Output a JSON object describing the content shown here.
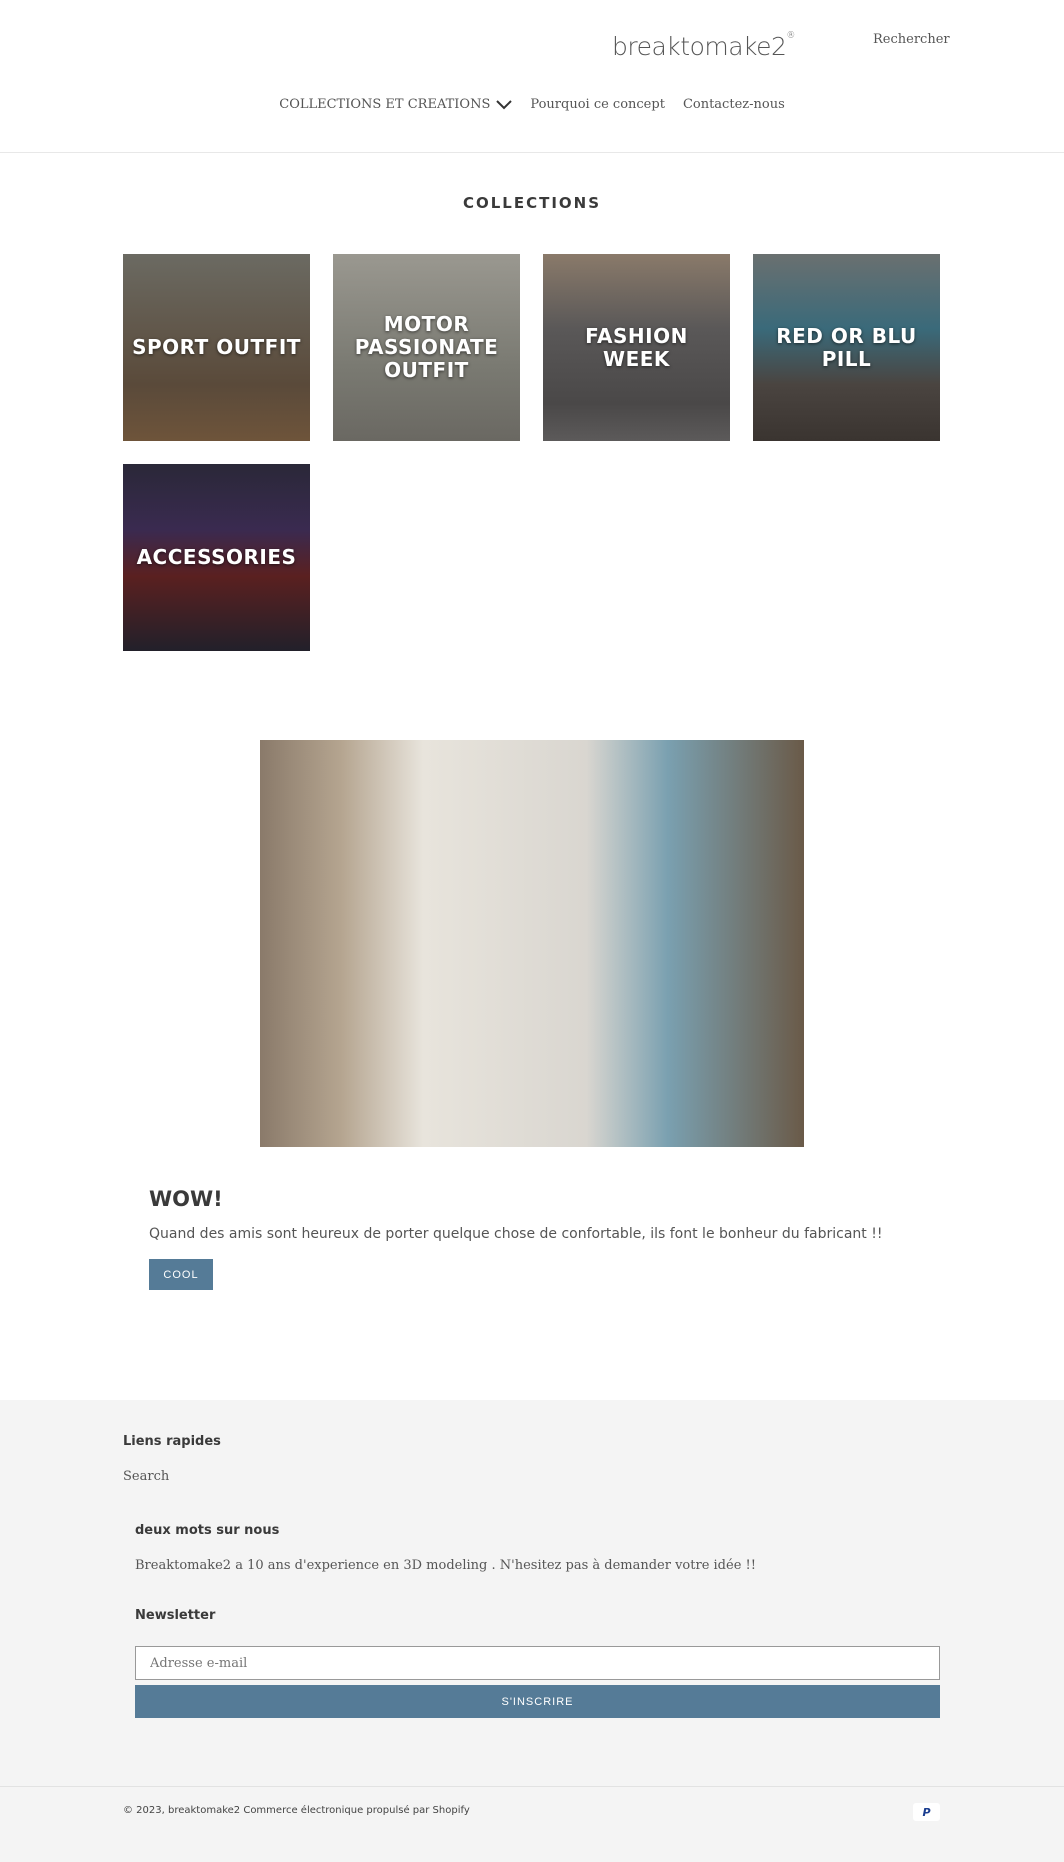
{
  "header": {
    "logo": "breaktomake2",
    "logo_mark": "®",
    "search": "Rechercher",
    "nav": [
      {
        "label": "COLLECTIONS ET CREATIONS"
      },
      {
        "label": "Pourquoi ce concept"
      },
      {
        "label": "Contactez-nous"
      }
    ]
  },
  "collections": {
    "title": "COLLECTIONS",
    "items": [
      {
        "label": "SPORT OUTFIT",
        "color": "#5e5548"
      },
      {
        "label": "MOTOR PASSIONATE OUTFIT",
        "color": "#7d7a72"
      },
      {
        "label": "FASHION WEEK",
        "color": "#5c5a5a"
      },
      {
        "label": "RED OR BLU PILL",
        "color": "#4e5a60"
      },
      {
        "label": "ACCESSORIES",
        "color": "#2c2838"
      }
    ]
  },
  "feature": {
    "title": "WOW!",
    "text": "Quand des amis sont heureux de porter quelque chose de confortable, ils font le bonheur du fabricant !!",
    "button": "COOL"
  },
  "footer": {
    "quick_links_title": "Liens rapides",
    "quick_links": [
      "Search"
    ],
    "about_title": "deux mots sur nous",
    "about_text": "Breaktomake2 a 10 ans d'experience en 3D modeling . N'hesitez pas à demander votre idée !!",
    "newsletter_title": "Newsletter",
    "email_placeholder": "Adresse e-mail",
    "subscribe": "S'INSCRIRE",
    "copyright": "© 2023, breaktomake2 Commerce électronique propulsé par Shopify",
    "payment_icon": "paypal-icon"
  },
  "colors": {
    "accent": "#557b97",
    "footer_bg": "#f4f4f4"
  }
}
